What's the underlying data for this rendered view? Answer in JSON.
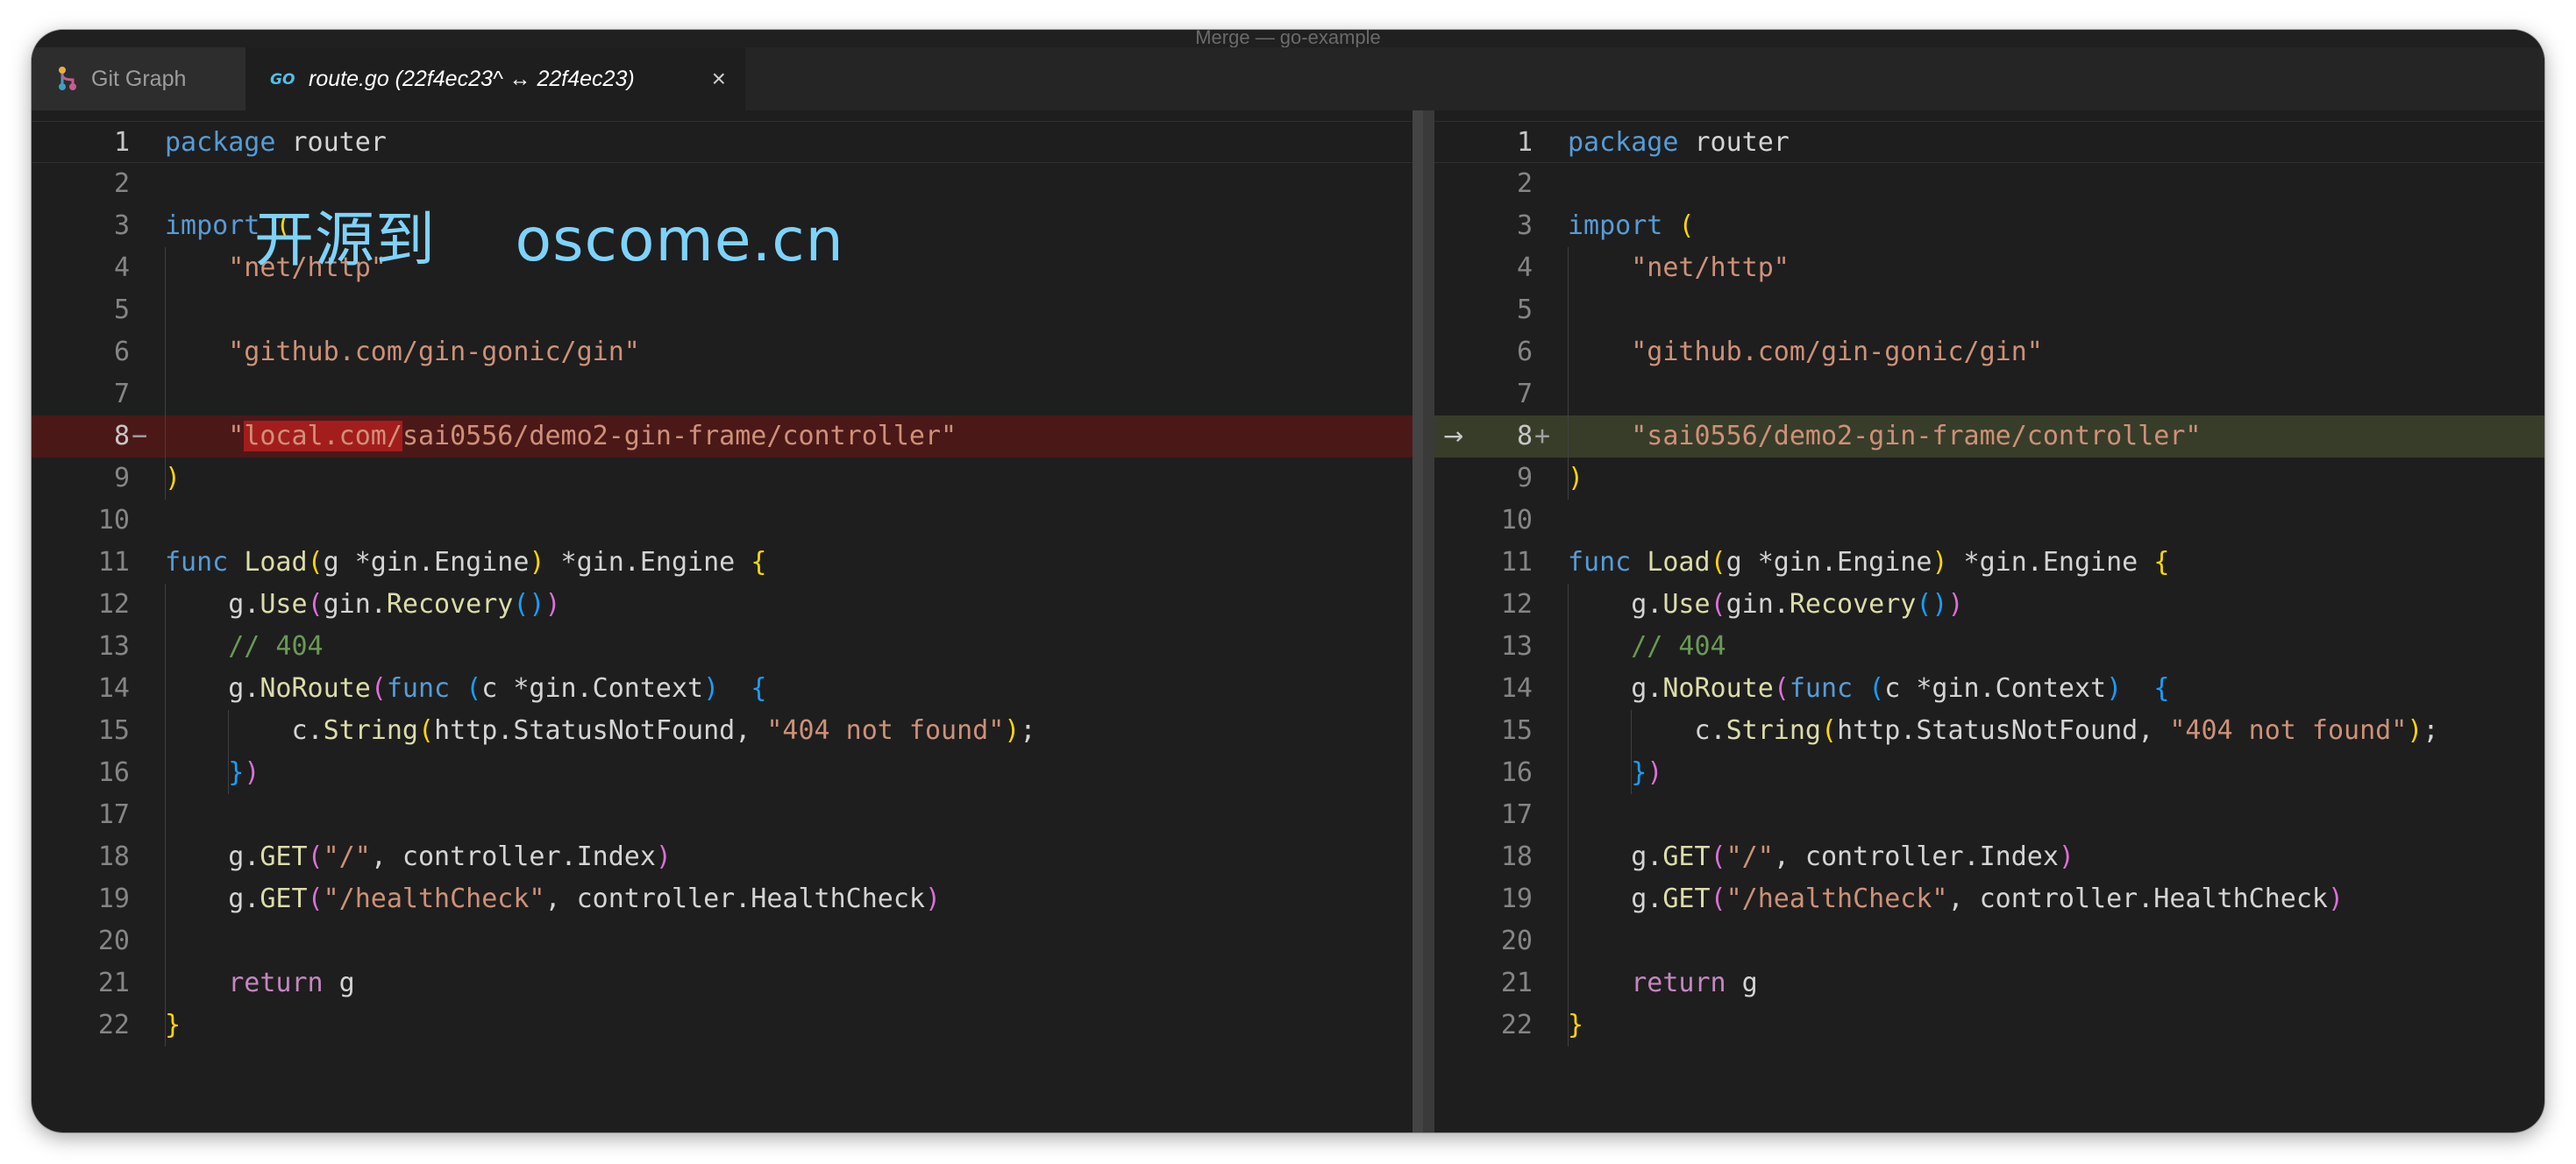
{
  "window": {
    "title": "Merge — go-example"
  },
  "tabs": [
    {
      "label": "Git Graph",
      "icon": "git-graph-icon"
    },
    {
      "label": "route.go (22f4ec23^ ↔ 22f4ec23)",
      "icon": "go-file-icon",
      "close": "×"
    }
  ],
  "watermark": {
    "cn": "开源到",
    "domain": "oscome.cn"
  },
  "colors": {
    "removed_line": "#4b1818",
    "removed_word": "#a31d1d",
    "added_line": "#373d29",
    "editor_bg": "#1e1e1e"
  },
  "left": {
    "marker": "−",
    "lines": [
      [
        {
          "t": "package",
          "c": "k"
        },
        {
          "t": " router"
        }
      ],
      [],
      [
        {
          "t": "import",
          "c": "k"
        },
        {
          "t": " "
        },
        {
          "t": "(",
          "c": "b1"
        }
      ],
      [
        {
          "t": "    "
        },
        {
          "t": "\"net/http\"",
          "c": "s"
        }
      ],
      [],
      [
        {
          "t": "    "
        },
        {
          "t": "\"github.com/gin-gonic/gin\"",
          "c": "s"
        }
      ],
      [],
      [
        {
          "t": "    "
        },
        {
          "t": "\"",
          "c": "s"
        },
        {
          "t": "local.com/",
          "c": "s",
          "hl": "removed-word"
        },
        {
          "t": "sai0556/demo2-gin-frame/controller\"",
          "c": "s"
        }
      ],
      [
        {
          "t": ")",
          "c": "b1"
        }
      ],
      [],
      [
        {
          "t": "func",
          "c": "k"
        },
        {
          "t": " "
        },
        {
          "t": "Load",
          "c": "f"
        },
        {
          "t": "(",
          "c": "b1"
        },
        {
          "t": "g *gin.Engine"
        },
        {
          "t": ")",
          "c": "b1"
        },
        {
          "t": " *gin.Engine "
        },
        {
          "t": "{",
          "c": "b1"
        }
      ],
      [
        {
          "t": "    g."
        },
        {
          "t": "Use",
          "c": "f"
        },
        {
          "t": "(",
          "c": "b2"
        },
        {
          "t": "gin."
        },
        {
          "t": "Recovery",
          "c": "f"
        },
        {
          "t": "()",
          "c": "b3"
        },
        {
          "t": ")",
          "c": "b2"
        }
      ],
      [
        {
          "t": "    "
        },
        {
          "t": "// 404",
          "c": "c"
        }
      ],
      [
        {
          "t": "    g."
        },
        {
          "t": "NoRoute",
          "c": "f"
        },
        {
          "t": "(",
          "c": "b2"
        },
        {
          "t": "func",
          "c": "k"
        },
        {
          "t": " "
        },
        {
          "t": "(",
          "c": "b3"
        },
        {
          "t": "c *gin.Context"
        },
        {
          "t": ")",
          "c": "b3"
        },
        {
          "t": "  "
        },
        {
          "t": "{",
          "c": "b3"
        }
      ],
      [
        {
          "t": "        c."
        },
        {
          "t": "String",
          "c": "f"
        },
        {
          "t": "(",
          "c": "b1"
        },
        {
          "t": "http.StatusNotFound, "
        },
        {
          "t": "\"404 not found\"",
          "c": "s"
        },
        {
          "t": ")",
          "c": "b1"
        },
        {
          "t": ";"
        }
      ],
      [
        {
          "t": "    "
        },
        {
          "t": "}",
          "c": "b3"
        },
        {
          "t": ")",
          "c": "b2"
        }
      ],
      [],
      [
        {
          "t": "    g."
        },
        {
          "t": "GET",
          "c": "f"
        },
        {
          "t": "(",
          "c": "b2"
        },
        {
          "t": "\"/\"",
          "c": "s"
        },
        {
          "t": ", controller.Index"
        },
        {
          "t": ")",
          "c": "b2"
        }
      ],
      [
        {
          "t": "    g."
        },
        {
          "t": "GET",
          "c": "f"
        },
        {
          "t": "(",
          "c": "b2"
        },
        {
          "t": "\"/healthCheck\"",
          "c": "s"
        },
        {
          "t": ", controller.HealthCheck"
        },
        {
          "t": ")",
          "c": "b2"
        }
      ],
      [],
      [
        {
          "t": "    "
        },
        {
          "t": "return",
          "c": "kc"
        },
        {
          "t": " g"
        }
      ],
      [
        {
          "t": "}",
          "c": "b1"
        }
      ]
    ]
  },
  "right": {
    "marker": "+",
    "arrow": "→",
    "lines": [
      [
        {
          "t": "package",
          "c": "k"
        },
        {
          "t": " router"
        }
      ],
      [],
      [
        {
          "t": "import",
          "c": "k"
        },
        {
          "t": " "
        },
        {
          "t": "(",
          "c": "b1"
        }
      ],
      [
        {
          "t": "    "
        },
        {
          "t": "\"net/http\"",
          "c": "s"
        }
      ],
      [],
      [
        {
          "t": "    "
        },
        {
          "t": "\"github.com/gin-gonic/gin\"",
          "c": "s"
        }
      ],
      [],
      [
        {
          "t": "    "
        },
        {
          "t": "\"sai0556/demo2-gin-frame/controller\"",
          "c": "s"
        }
      ],
      [
        {
          "t": ")",
          "c": "b1"
        }
      ],
      [],
      [
        {
          "t": "func",
          "c": "k"
        },
        {
          "t": " "
        },
        {
          "t": "Load",
          "c": "f"
        },
        {
          "t": "(",
          "c": "b1"
        },
        {
          "t": "g *gin.Engine"
        },
        {
          "t": ")",
          "c": "b1"
        },
        {
          "t": " *gin.Engine "
        },
        {
          "t": "{",
          "c": "b1"
        }
      ],
      [
        {
          "t": "    g."
        },
        {
          "t": "Use",
          "c": "f"
        },
        {
          "t": "(",
          "c": "b2"
        },
        {
          "t": "gin."
        },
        {
          "t": "Recovery",
          "c": "f"
        },
        {
          "t": "()",
          "c": "b3"
        },
        {
          "t": ")",
          "c": "b2"
        }
      ],
      [
        {
          "t": "    "
        },
        {
          "t": "// 404",
          "c": "c"
        }
      ],
      [
        {
          "t": "    g."
        },
        {
          "t": "NoRoute",
          "c": "f"
        },
        {
          "t": "(",
          "c": "b2"
        },
        {
          "t": "func",
          "c": "k"
        },
        {
          "t": " "
        },
        {
          "t": "(",
          "c": "b3"
        },
        {
          "t": "c *gin.Context"
        },
        {
          "t": ")",
          "c": "b3"
        },
        {
          "t": "  "
        },
        {
          "t": "{",
          "c": "b3"
        }
      ],
      [
        {
          "t": "        c."
        },
        {
          "t": "String",
          "c": "f"
        },
        {
          "t": "(",
          "c": "b1"
        },
        {
          "t": "http.StatusNotFound, "
        },
        {
          "t": "\"404 not found\"",
          "c": "s"
        },
        {
          "t": ")",
          "c": "b1"
        },
        {
          "t": ";"
        }
      ],
      [
        {
          "t": "    "
        },
        {
          "t": "}",
          "c": "b3"
        },
        {
          "t": ")",
          "c": "b2"
        }
      ],
      [],
      [
        {
          "t": "    g."
        },
        {
          "t": "GET",
          "c": "f"
        },
        {
          "t": "(",
          "c": "b2"
        },
        {
          "t": "\"/\"",
          "c": "s"
        },
        {
          "t": ", controller.Index"
        },
        {
          "t": ")",
          "c": "b2"
        }
      ],
      [
        {
          "t": "    g."
        },
        {
          "t": "GET",
          "c": "f"
        },
        {
          "t": "(",
          "c": "b2"
        },
        {
          "t": "\"/healthCheck\"",
          "c": "s"
        },
        {
          "t": ", controller.HealthCheck"
        },
        {
          "t": ")",
          "c": "b2"
        }
      ],
      [],
      [
        {
          "t": "    "
        },
        {
          "t": "return",
          "c": "kc"
        },
        {
          "t": " g"
        }
      ],
      [
        {
          "t": "}",
          "c": "b1"
        }
      ]
    ]
  }
}
